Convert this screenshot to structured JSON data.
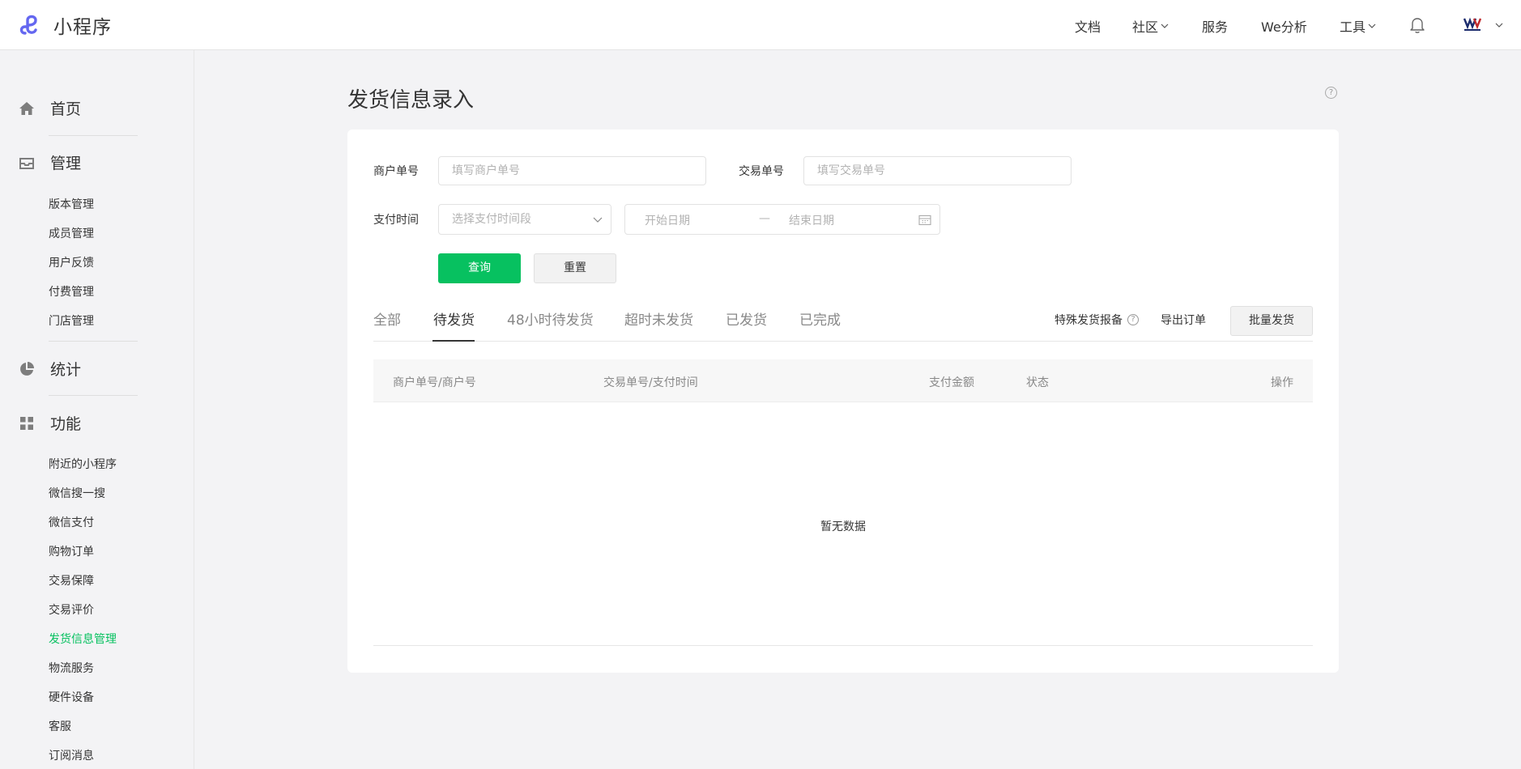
{
  "header": {
    "app_title": "小程序",
    "nav": [
      {
        "label": "文档",
        "has_dropdown": false
      },
      {
        "label": "社区",
        "has_dropdown": true
      },
      {
        "label": "服务",
        "has_dropdown": false
      },
      {
        "label": "We分析",
        "has_dropdown": false
      },
      {
        "label": "工具",
        "has_dropdown": true
      }
    ],
    "icons": [
      "bell-icon",
      "avatar",
      "chevron-down-icon"
    ]
  },
  "sidebar": {
    "sections": [
      {
        "label": "首页",
        "icon": "home-icon"
      },
      {
        "label": "管理",
        "icon": "inbox-icon"
      },
      {
        "label": "统计",
        "icon": "pie-chart-icon"
      },
      {
        "label": "功能",
        "icon": "grid-icon"
      }
    ],
    "manage_items": [
      "版本管理",
      "成员管理",
      "用户反馈",
      "付费管理",
      "门店管理"
    ],
    "feature_items": [
      "附近的小程序",
      "微信搜一搜",
      "微信支付",
      "购物订单",
      "交易保障",
      "交易评价",
      "发货信息管理",
      "物流服务",
      "硬件设备",
      "客服",
      "订阅消息"
    ],
    "active_item": "发货信息管理",
    "accent_color": "#07c160"
  },
  "main": {
    "title": "发货信息录入",
    "form": {
      "merchant_order_label": "商户单号",
      "merchant_order_placeholder": "填写商户单号",
      "transaction_label": "交易单号",
      "transaction_placeholder": "填写交易单号",
      "pay_time_label": "支付时间",
      "pay_time_select": "选择支付时间段",
      "start_date": "开始日期",
      "range_sep": "—",
      "end_date": "结束日期",
      "query_button": "查询",
      "reset_button": "重置"
    },
    "tabs": [
      "全部",
      "待发货",
      "48小时待发货",
      "超时未发货",
      "已发货",
      "已完成"
    ],
    "active_tab": "待发货",
    "actions": {
      "special_report": "特殊发货报备",
      "export": "导出订单",
      "batch_ship": "批量发货"
    },
    "table": {
      "columns": [
        "商户单号/商户号",
        "交易单号/支付时间",
        "支付金额",
        "状态",
        "操作"
      ],
      "empty_text": "暂无数据"
    }
  }
}
